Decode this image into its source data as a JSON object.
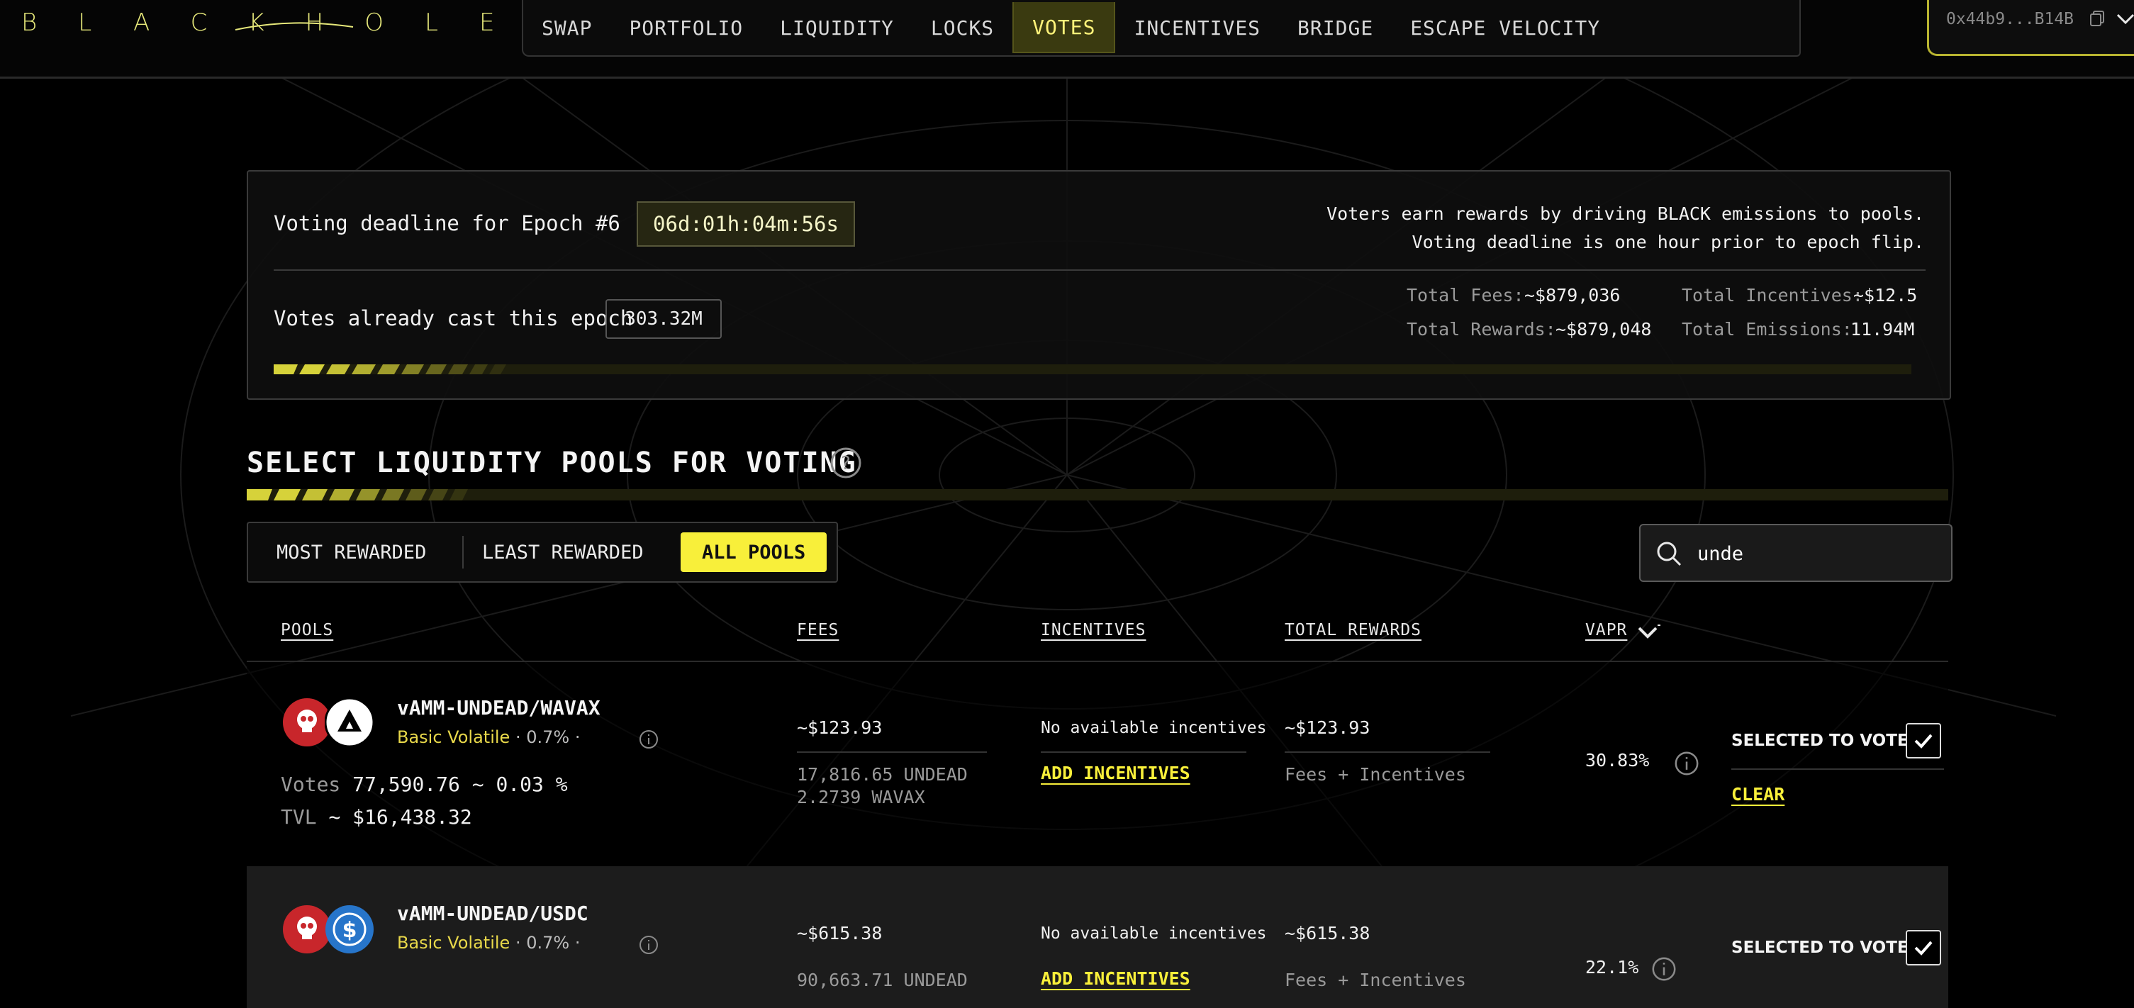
{
  "header": {
    "logo_text": "BLACKHOLE",
    "nav": [
      {
        "label": "SWAP",
        "active": false
      },
      {
        "label": "PORTFOLIO",
        "active": false
      },
      {
        "label": "LIQUIDITY",
        "active": false
      },
      {
        "label": "LOCKS",
        "active": false
      },
      {
        "label": "VOTES",
        "active": true
      },
      {
        "label": "INCENTIVES",
        "active": false
      },
      {
        "label": "BRIDGE",
        "active": false
      },
      {
        "label": "ESCAPE VELOCITY",
        "active": false
      }
    ],
    "wallet_address": "0x44b9...B14B",
    "wallet_icons": [
      "copy-icon",
      "chevron-down-icon"
    ]
  },
  "epoch": {
    "deadline_label": "Voting deadline for Epoch #6",
    "countdown": "06d:01h:04m:56s",
    "votes_cast_label": "Votes already cast this epoch",
    "votes_cast_value": "303.32M",
    "note_line1": "Voters earn rewards by driving BLACK emissions to pools.",
    "note_line2": "Voting deadline is one hour prior to epoch flip.",
    "total_fees_label": "Total Fees:",
    "total_fees_value": "~$879,036",
    "total_incentives_label": "Total Incentives:",
    "total_incentives_value": "~$12.5",
    "total_rewards_label": "Total Rewards:",
    "total_rewards_value": "~$879,048",
    "total_emissions_label": "Total Emissions:",
    "total_emissions_value": "11.94M"
  },
  "section": {
    "title": "SELECT LIQUIDITY POOLS FOR VOTING"
  },
  "filters": {
    "most_rewarded": "MOST REWARDED",
    "least_rewarded": "LEAST REWARDED",
    "all_pools": "ALL POOLS",
    "active": "ALL POOLS"
  },
  "search": {
    "value": "unde"
  },
  "table": {
    "columns": {
      "pools": "POOLS",
      "fees": "FEES",
      "incentives": "INCENTIVES",
      "total_rewards": "TOTAL REWARDS",
      "vapr": "VAPR"
    },
    "rows": [
      {
        "name": "vAMM-UNDEAD/WAVAX",
        "type": "Basic Volatile",
        "fee_tier": "0.7%",
        "votes_label": "Votes",
        "votes_value": "77,590.76 ~",
        "votes_pct": "0.03 %",
        "tvl_label": "TVL",
        "tvl_value": "~ $16,438.32",
        "fees_value": "~$123.93",
        "fees_token1": "17,816.65 UNDEAD",
        "fees_token2": "2.2739 WAVAX",
        "incentives_text": "No available incentives",
        "add_incentives": "ADD INCENTIVES",
        "total_rewards_value": "~$123.93",
        "total_rewards_sub": "Fees + Incentives",
        "vapr": "30.83%",
        "vote_status": "SELECTED TO VOTE",
        "clear": "CLEAR",
        "selected": true
      },
      {
        "name": "vAMM-UNDEAD/USDC",
        "type": "Basic Volatile",
        "fee_tier": "0.7%",
        "fees_value": "~$615.38",
        "fees_token1": "90,663.71 UNDEAD",
        "incentives_text": "No available incentives",
        "add_incentives": "ADD INCENTIVES",
        "total_rewards_value": "~$615.38",
        "total_rewards_sub": "Fees + Incentives",
        "vapr": "22.1%",
        "vote_status": "SELECTED TO VOTE",
        "selected": true
      }
    ]
  },
  "colors": {
    "accent_yellow": "#f8ef3a",
    "pool_type_yellow": "#e8d84a",
    "background": "#000000",
    "undead_red": "#c8262b",
    "usdc_blue": "#2775ca"
  }
}
